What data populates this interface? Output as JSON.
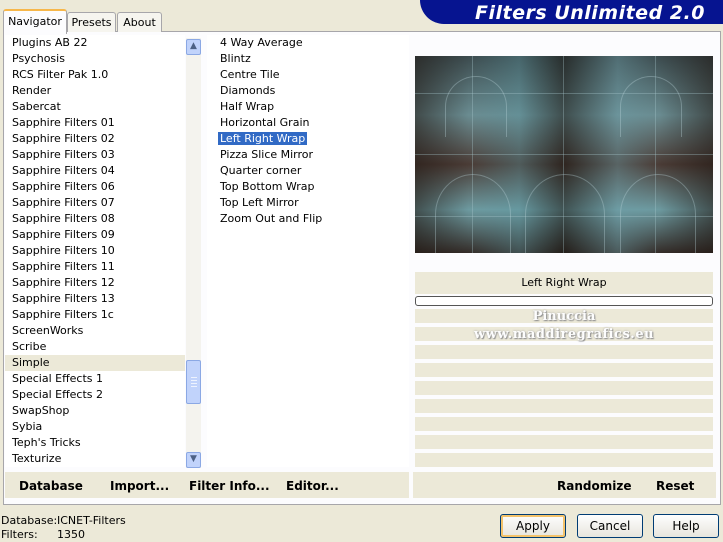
{
  "banner": {
    "title": "Filters Unlimited 2.0"
  },
  "tabs": {
    "navigator": "Navigator",
    "presets": "Presets",
    "about": "About"
  },
  "categories": {
    "items": [
      "Plugins AB 22",
      "Psychosis",
      "RCS Filter Pak 1.0",
      "Render",
      "Sabercat",
      "Sapphire Filters 01",
      "Sapphire Filters 02",
      "Sapphire Filters 03",
      "Sapphire Filters 04",
      "Sapphire Filters 06",
      "Sapphire Filters 07",
      "Sapphire Filters 08",
      "Sapphire Filters 09",
      "Sapphire Filters 10",
      "Sapphire Filters 11",
      "Sapphire Filters 12",
      "Sapphire Filters 13",
      "Sapphire Filters 1c",
      "ScreenWorks",
      "Scribe",
      "Simple",
      "Special Effects 1",
      "Special Effects 2",
      "SwapShop",
      "Sybia",
      "Teph's Tricks",
      "Texturize"
    ],
    "selected": "Simple"
  },
  "filters": {
    "items": [
      "4 Way Average",
      "Blintz",
      "Centre Tile",
      "Diamonds",
      "Half Wrap",
      "Horizontal Grain",
      "Left Right Wrap",
      "Pizza Slice Mirror",
      "Quarter corner",
      "Top Bottom Wrap",
      "Top Left Mirror",
      "Zoom Out and Flip"
    ],
    "selected": "Left Right Wrap"
  },
  "preview": {
    "label": "Left Right Wrap",
    "watermark_line1": "Pinuccia",
    "watermark_line2": "www.maddiregrafics.eu"
  },
  "toolbar": {
    "database": "Database",
    "import": "Import...",
    "filter_info": "Filter Info...",
    "editor": "Editor...",
    "randomize": "Randomize",
    "reset": "Reset"
  },
  "status": {
    "database_label": "Database:",
    "database_value": "ICNET-Filters",
    "filters_label": "Filters:",
    "filters_value": "1350"
  },
  "buttons": {
    "apply": "Apply",
    "cancel": "Cancel",
    "help": "Help"
  },
  "colors": {
    "banner": "#061490",
    "selection": "#316ac5",
    "background": "#ece9d8"
  }
}
